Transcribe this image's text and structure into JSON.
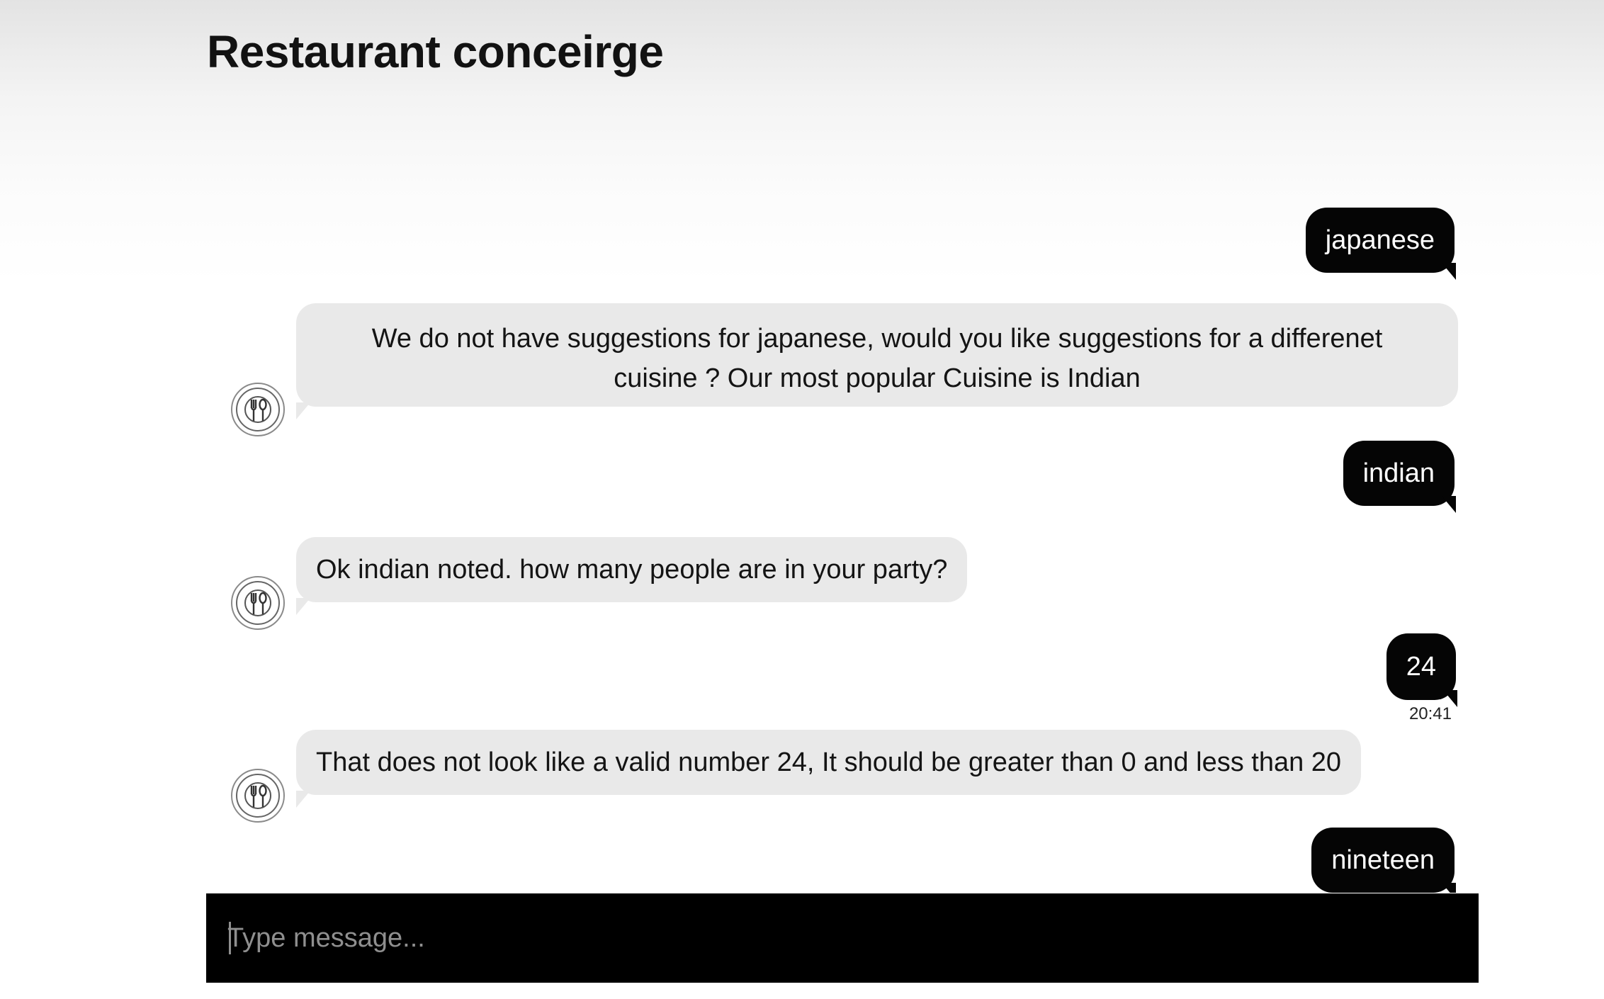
{
  "app": {
    "title": "Restaurant conceirge"
  },
  "conversation": {
    "messages": [
      {
        "sender": "user",
        "text": "japanese"
      },
      {
        "sender": "bot",
        "text": "We do not have suggestions for japanese, would you like suggestions for a differenet cuisine ? Our most popular Cuisine is Indian"
      },
      {
        "sender": "user",
        "text": "indian"
      },
      {
        "sender": "bot",
        "text": "Ok indian noted. how many people are in your party?"
      },
      {
        "sender": "user",
        "text": "24",
        "time": "20:41"
      },
      {
        "sender": "bot",
        "text": "That does not look like a valid number 24, It should be greater than 0 and less than 20"
      },
      {
        "sender": "user",
        "text": "nineteen"
      }
    ],
    "bot_avatar_icon": "restaurant-plate-cutlery-icon"
  },
  "composer": {
    "placeholder": "Type message..."
  }
}
